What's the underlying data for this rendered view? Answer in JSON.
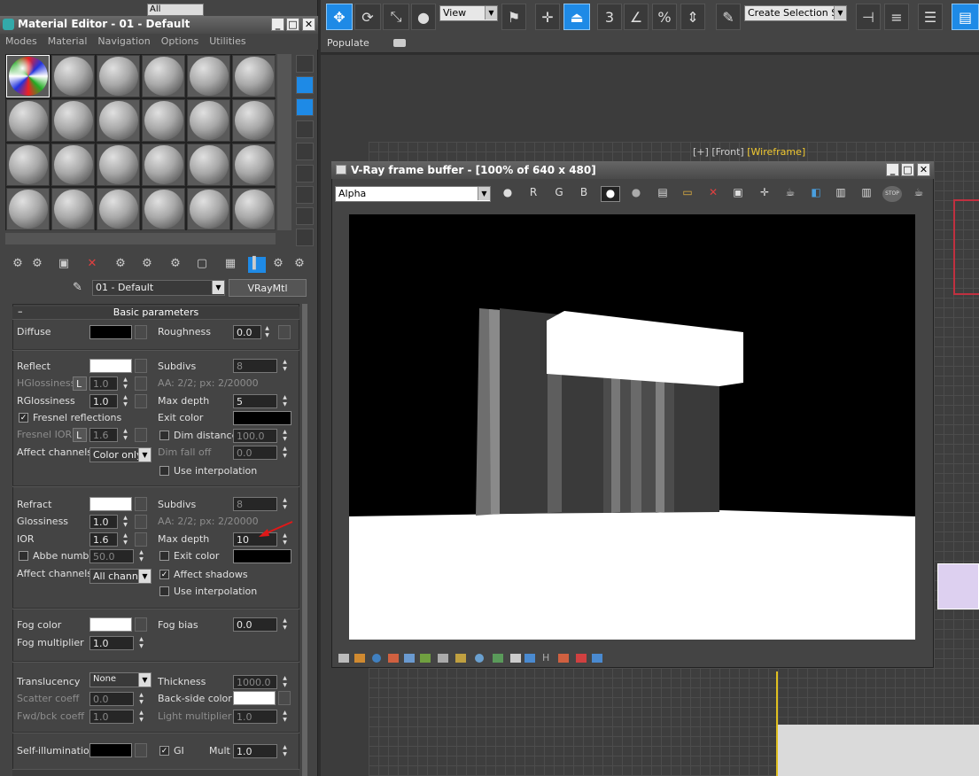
{
  "toolbar": {
    "selection_filter": "All",
    "view_label": "View",
    "snap_3_label": "3",
    "percent_label": "%",
    "named_selection_placeholder": "Create Selection Se",
    "ribbon_populate": "Populate"
  },
  "viewport": {
    "label_plus": "[+]",
    "label_view": "[Front]",
    "label_mode": "[Wireframe]"
  },
  "material_editor": {
    "title": "Material Editor - 01 - Default",
    "menus": [
      "Modes",
      "Material",
      "Navigation",
      "Options",
      "Utilities"
    ],
    "material_name": "01 - Default",
    "material_type": "VRayMtl",
    "rollout_title": "Basic parameters",
    "diffuse": {
      "label": "Diffuse",
      "color": "#000000"
    },
    "roughness": {
      "label": "Roughness",
      "value": "0.0"
    },
    "reflect": {
      "label": "Reflect",
      "color": "#ffffff",
      "subdivs_label": "Subdivs",
      "subdivs": "8",
      "hgloss_label": "HGlossiness",
      "hgloss_lock": "L",
      "hgloss": "1.0",
      "aa_text": "AA: 2/2; px: 2/20000",
      "rgloss_label": "RGlossiness",
      "rgloss": "1.0",
      "maxdepth_label": "Max depth",
      "maxdepth": "5",
      "fresnel_label": "Fresnel reflections",
      "exit_label": "Exit color",
      "exit_color": "#000000",
      "fresnel_ior_label": "Fresnel IOR",
      "fresnel_ior_lock": "L",
      "fresnel_ior": "1.6",
      "dim_distance_label": "Dim distance",
      "dim_distance": "100.0",
      "affect_label": "Affect channels",
      "affect_value": "Color only",
      "dim_falloff_label": "Dim fall off",
      "dim_falloff": "0.0",
      "use_interp_label": "Use interpolation"
    },
    "refract": {
      "label": "Refract",
      "color": "#ffffff",
      "subdivs_label": "Subdivs",
      "subdivs": "8",
      "gloss_label": "Glossiness",
      "gloss": "1.0",
      "aa_text": "AA: 2/2; px: 2/20000",
      "ior_label": "IOR",
      "ior": "1.6",
      "maxdepth_label": "Max depth",
      "maxdepth": "10",
      "abbe_label": "Abbe number",
      "abbe": "50.0",
      "exit_label": "Exit color",
      "exit_color": "#000000",
      "affect_label": "Affect channels",
      "affect_value": "All channe",
      "affect_shadows_label": "Affect shadows",
      "use_interp_label": "Use interpolation"
    },
    "fog": {
      "color_label": "Fog color",
      "color": "#ffffff",
      "bias_label": "Fog bias",
      "bias": "0.0",
      "mult_label": "Fog multiplier",
      "mult": "1.0"
    },
    "translucency": {
      "label": "Translucency",
      "value": "None",
      "thickness_label": "Thickness",
      "thickness": "1000.0",
      "scatter_label": "Scatter coeff",
      "scatter": "0.0",
      "backside_label": "Back-side color",
      "backside_color": "#ffffff",
      "fwdbck_label": "Fwd/bck coeff",
      "fwdbck": "1.0",
      "lightmult_label": "Light multiplier",
      "lightmult": "1.0"
    },
    "selfillum": {
      "label": "Self-illumination",
      "color": "#000000",
      "gi_label": "GI",
      "mult_label": "Mult",
      "mult": "1.0"
    }
  },
  "vfb": {
    "title": "V-Ray frame buffer - [100% of 640 x 480]",
    "channel": "Alpha",
    "r": "R",
    "g": "G",
    "b": "B",
    "stop_label": "STOP"
  }
}
